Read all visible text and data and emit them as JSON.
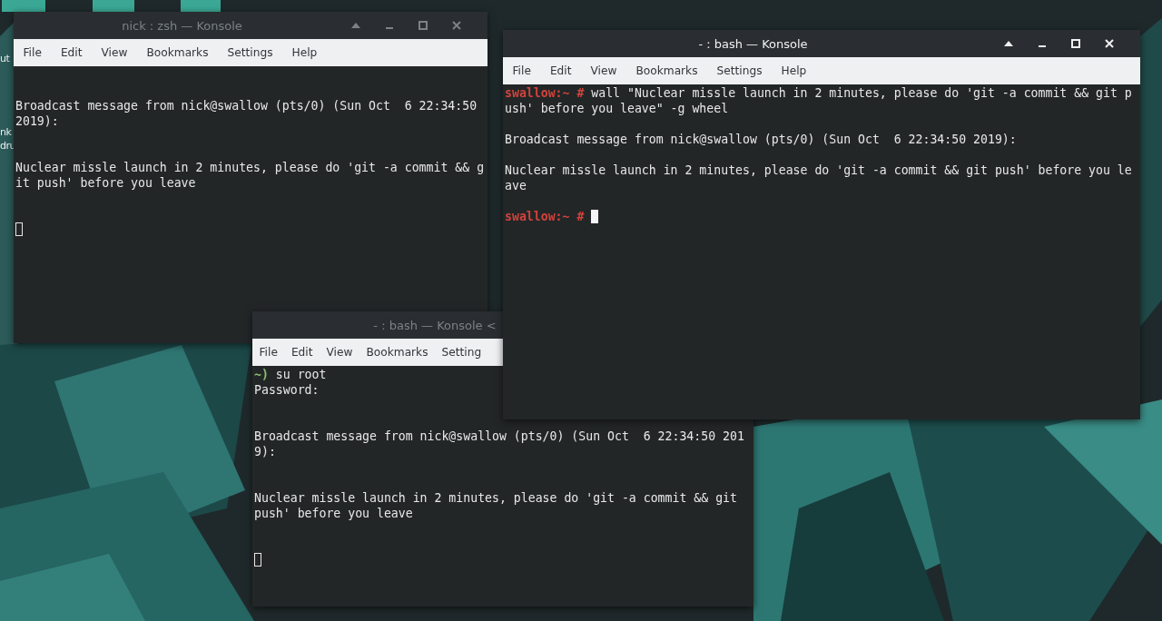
{
  "desktop": {
    "icon_labels": [
      "ut",
      "nk",
      "dru"
    ]
  },
  "windows": [
    {
      "title": "nick : zsh — Konsole",
      "active": false,
      "show_controls": true,
      "menu": [
        "File",
        "Edit",
        "View",
        "Bookmarks",
        "Settings",
        "Help"
      ],
      "lines": [
        {
          "kind": "blank"
        },
        {
          "kind": "blank"
        },
        {
          "kind": "output",
          "text": "Broadcast message from nick@swallow (pts/0) (Sun Oct  6 22:34:50"
        },
        {
          "kind": "output",
          "text": "2019):"
        },
        {
          "kind": "blank"
        },
        {
          "kind": "blank"
        },
        {
          "kind": "output",
          "text": "Nuclear missle launch in 2 minutes, please do 'git -a commit && g"
        },
        {
          "kind": "output",
          "text": "it push' before you leave"
        },
        {
          "kind": "blank"
        },
        {
          "kind": "blank"
        },
        {
          "kind": "cursor"
        }
      ]
    },
    {
      "title": "- : bash — Konsole <",
      "active": false,
      "show_controls": false,
      "menu": [
        "File",
        "Edit",
        "View",
        "Bookmarks",
        "Setting"
      ],
      "lines": [
        {
          "kind": "prompt",
          "prompt": "~)",
          "color": "#8cc06f",
          "text": "su root"
        },
        {
          "kind": "output",
          "text": "Password:"
        },
        {
          "kind": "blank"
        },
        {
          "kind": "blank"
        },
        {
          "kind": "output",
          "text": "Broadcast message from nick@swallow (pts/0) (Sun Oct  6 22:34:50 201"
        },
        {
          "kind": "output",
          "text": "9):"
        },
        {
          "kind": "blank"
        },
        {
          "kind": "blank"
        },
        {
          "kind": "output",
          "text": "Nuclear missle launch in 2 minutes, please do 'git -a commit && git"
        },
        {
          "kind": "output",
          "text": "push' before you leave"
        },
        {
          "kind": "blank"
        },
        {
          "kind": "blank"
        },
        {
          "kind": "cursor"
        }
      ]
    },
    {
      "title": "- : bash — Konsole",
      "active": true,
      "show_controls": true,
      "menu": [
        "File",
        "Edit",
        "View",
        "Bookmarks",
        "Settings",
        "Help"
      ],
      "lines": [
        {
          "kind": "prompt",
          "prompt": "swallow:~ #",
          "color": "#d1433c",
          "text": "wall \"Nuclear missle launch in 2 minutes, please do 'git -a commit && git p"
        },
        {
          "kind": "output",
          "text": "ush' before you leave\" -g wheel"
        },
        {
          "kind": "blank"
        },
        {
          "kind": "output",
          "text": "Broadcast message from nick@swallow (pts/0) (Sun Oct  6 22:34:50 2019):"
        },
        {
          "kind": "blank"
        },
        {
          "kind": "output",
          "text": "Nuclear missle launch in 2 minutes, please do 'git -a commit && git push' before you le"
        },
        {
          "kind": "output",
          "text": "ave"
        },
        {
          "kind": "blank"
        },
        {
          "kind": "cursor",
          "prompt": "swallow:~ #",
          "color": "#d1433c"
        }
      ]
    }
  ]
}
